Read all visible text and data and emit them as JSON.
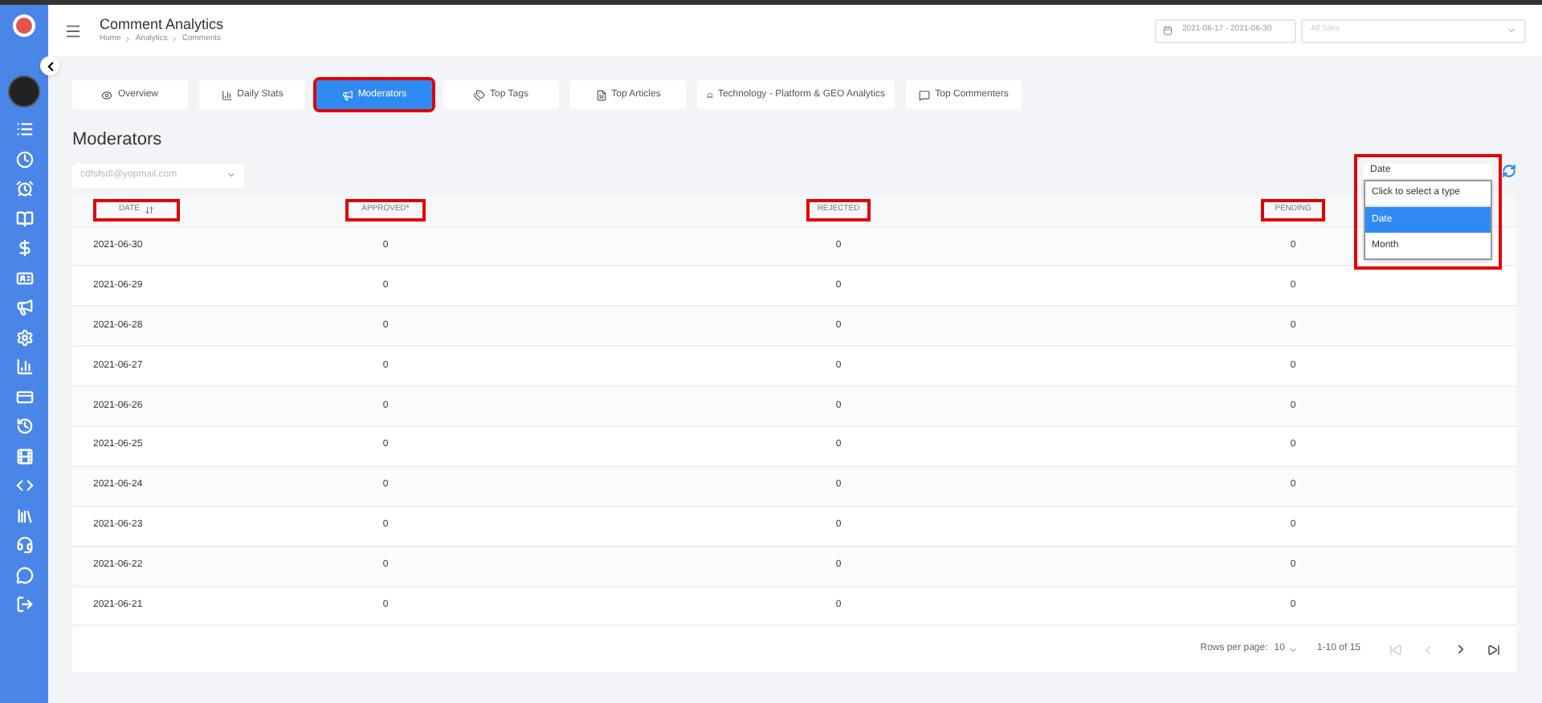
{
  "header": {
    "title": "Comment Analytics",
    "breadcrumb": [
      "Home",
      "Analytics",
      "Comments"
    ],
    "date_range": "2021-06-17 - 2021-06-30",
    "site_select": {
      "placeholder": "All Sites"
    }
  },
  "tabs": [
    {
      "label": "Overview",
      "selected": false,
      "highlighted": false
    },
    {
      "label": "Daily Stats",
      "selected": false,
      "highlighted": false
    },
    {
      "label": "Moderators",
      "selected": true,
      "highlighted": true
    },
    {
      "label": "Top Tags",
      "selected": false,
      "highlighted": false
    },
    {
      "label": "Top Articles",
      "selected": false,
      "highlighted": false
    },
    {
      "label": "Technology - Platform & GEO Analytics",
      "selected": false,
      "highlighted": false
    },
    {
      "label": "Top Commenters",
      "selected": false,
      "highlighted": false
    }
  ],
  "section_title": "Moderators",
  "moderator_select": {
    "value": "cdfsfsdl@yopmail.com"
  },
  "type_select": {
    "value": "Date",
    "highlighted": true,
    "options": [
      {
        "label": "Click to select a type",
        "selected": false
      },
      {
        "label": "Date",
        "selected": true
      },
      {
        "label": "Month",
        "selected": false
      }
    ]
  },
  "table": {
    "columns": [
      {
        "label": "DATE",
        "sortable": true,
        "highlighted": true
      },
      {
        "label": "APPROVED*",
        "sortable": false,
        "highlighted": true
      },
      {
        "label": "REJECTED",
        "sortable": false,
        "highlighted": true
      },
      {
        "label": "PENDING",
        "sortable": false,
        "highlighted": true
      }
    ],
    "rows": [
      [
        "2021-06-30",
        "0",
        "0",
        "0"
      ],
      [
        "2021-06-29",
        "0",
        "0",
        "0"
      ],
      [
        "2021-06-28",
        "0",
        "0",
        "0"
      ],
      [
        "2021-06-27",
        "0",
        "0",
        "0"
      ],
      [
        "2021-06-26",
        "0",
        "0",
        "0"
      ],
      [
        "2021-06-25",
        "0",
        "0",
        "0"
      ],
      [
        "2021-06-24",
        "0",
        "0",
        "0"
      ],
      [
        "2021-06-23",
        "0",
        "0",
        "0"
      ],
      [
        "2021-06-22",
        "0",
        "0",
        "0"
      ],
      [
        "2021-06-21",
        "0",
        "0",
        "0"
      ]
    ]
  },
  "pagination": {
    "rows_per_page_label": "Rows per page:",
    "rows_per_page": "10",
    "range": "1-10 of 15"
  }
}
